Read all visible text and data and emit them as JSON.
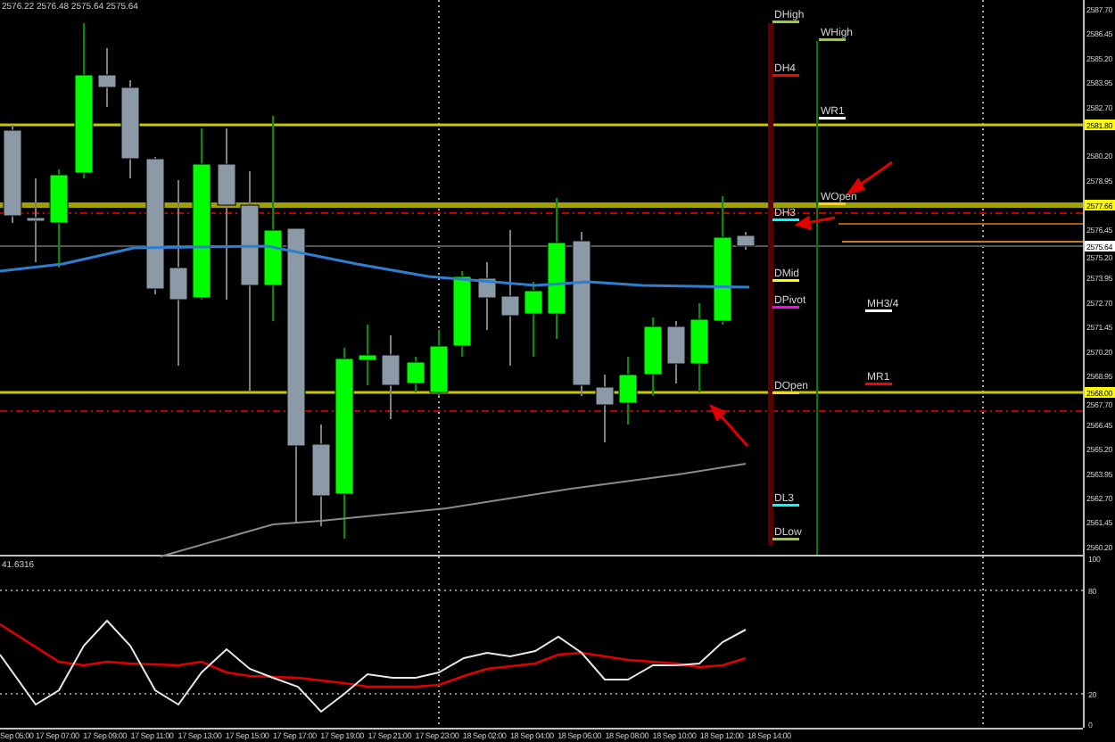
{
  "chart_header": "2576.22 2576.48 2575.64 2575.64",
  "price_axis": [
    "2587.70",
    "2586.45",
    "2585.20",
    "2583.95",
    "2582.70",
    "2580.20",
    "2578.95",
    "2576.45",
    "2575.20",
    "2573.95",
    "2572.70",
    "2571.45",
    "2570.20",
    "2568.95",
    "2567.70",
    "2566.45",
    "2565.20",
    "2563.95",
    "2562.70",
    "2561.45",
    "2560.20"
  ],
  "price_tags": [
    {
      "text": "2581.80",
      "color": "#ffff00"
    },
    {
      "text": "2577.66",
      "color": "#ffff00"
    },
    {
      "text": "2575.64",
      "color": "#ffffff"
    },
    {
      "text": "2568.00",
      "color": "#ffff00"
    }
  ],
  "levels": [
    {
      "label": "DHigh",
      "color": "#9acd32"
    },
    {
      "label": "DH4",
      "color": "#ff0000"
    },
    {
      "label": "DH3",
      "color": "#00ffff"
    },
    {
      "label": "DMid",
      "color": "#ffff00"
    },
    {
      "label": "DPivot",
      "color": "#ff00ff"
    },
    {
      "label": "DOpen",
      "color": "#ffd700"
    },
    {
      "label": "DL3",
      "color": "#00ffff"
    },
    {
      "label": "DLow",
      "color": "#9acd32"
    },
    {
      "label": "WHigh",
      "color": "#9acd32"
    },
    {
      "label": "WR1",
      "color": "#ffffff"
    },
    {
      "label": "WOpen",
      "color": "#ffd700"
    },
    {
      "label": "MH3/4",
      "color": "#ffffff"
    },
    {
      "label": "MR1",
      "color": "#ff0000"
    }
  ],
  "indicator": {
    "label": "41.6316",
    "axis": [
      "100",
      "80",
      "20",
      "0"
    ]
  },
  "time_axis": [
    "Sep 05:00",
    "17 Sep 07:00",
    "17 Sep 09:00",
    "17 Sep 11:00",
    "17 Sep 13:00",
    "17 Sep 15:00",
    "17 Sep 17:00",
    "17 Sep 19:00",
    "17 Sep 21:00",
    "17 Sep 23:00",
    "18 Sep 02:00",
    "18 Sep 04:00",
    "18 Sep 06:00",
    "18 Sep 08:00",
    "18 Sep 10:00",
    "18 Sep 12:00",
    "18 Sep 14:00"
  ]
}
